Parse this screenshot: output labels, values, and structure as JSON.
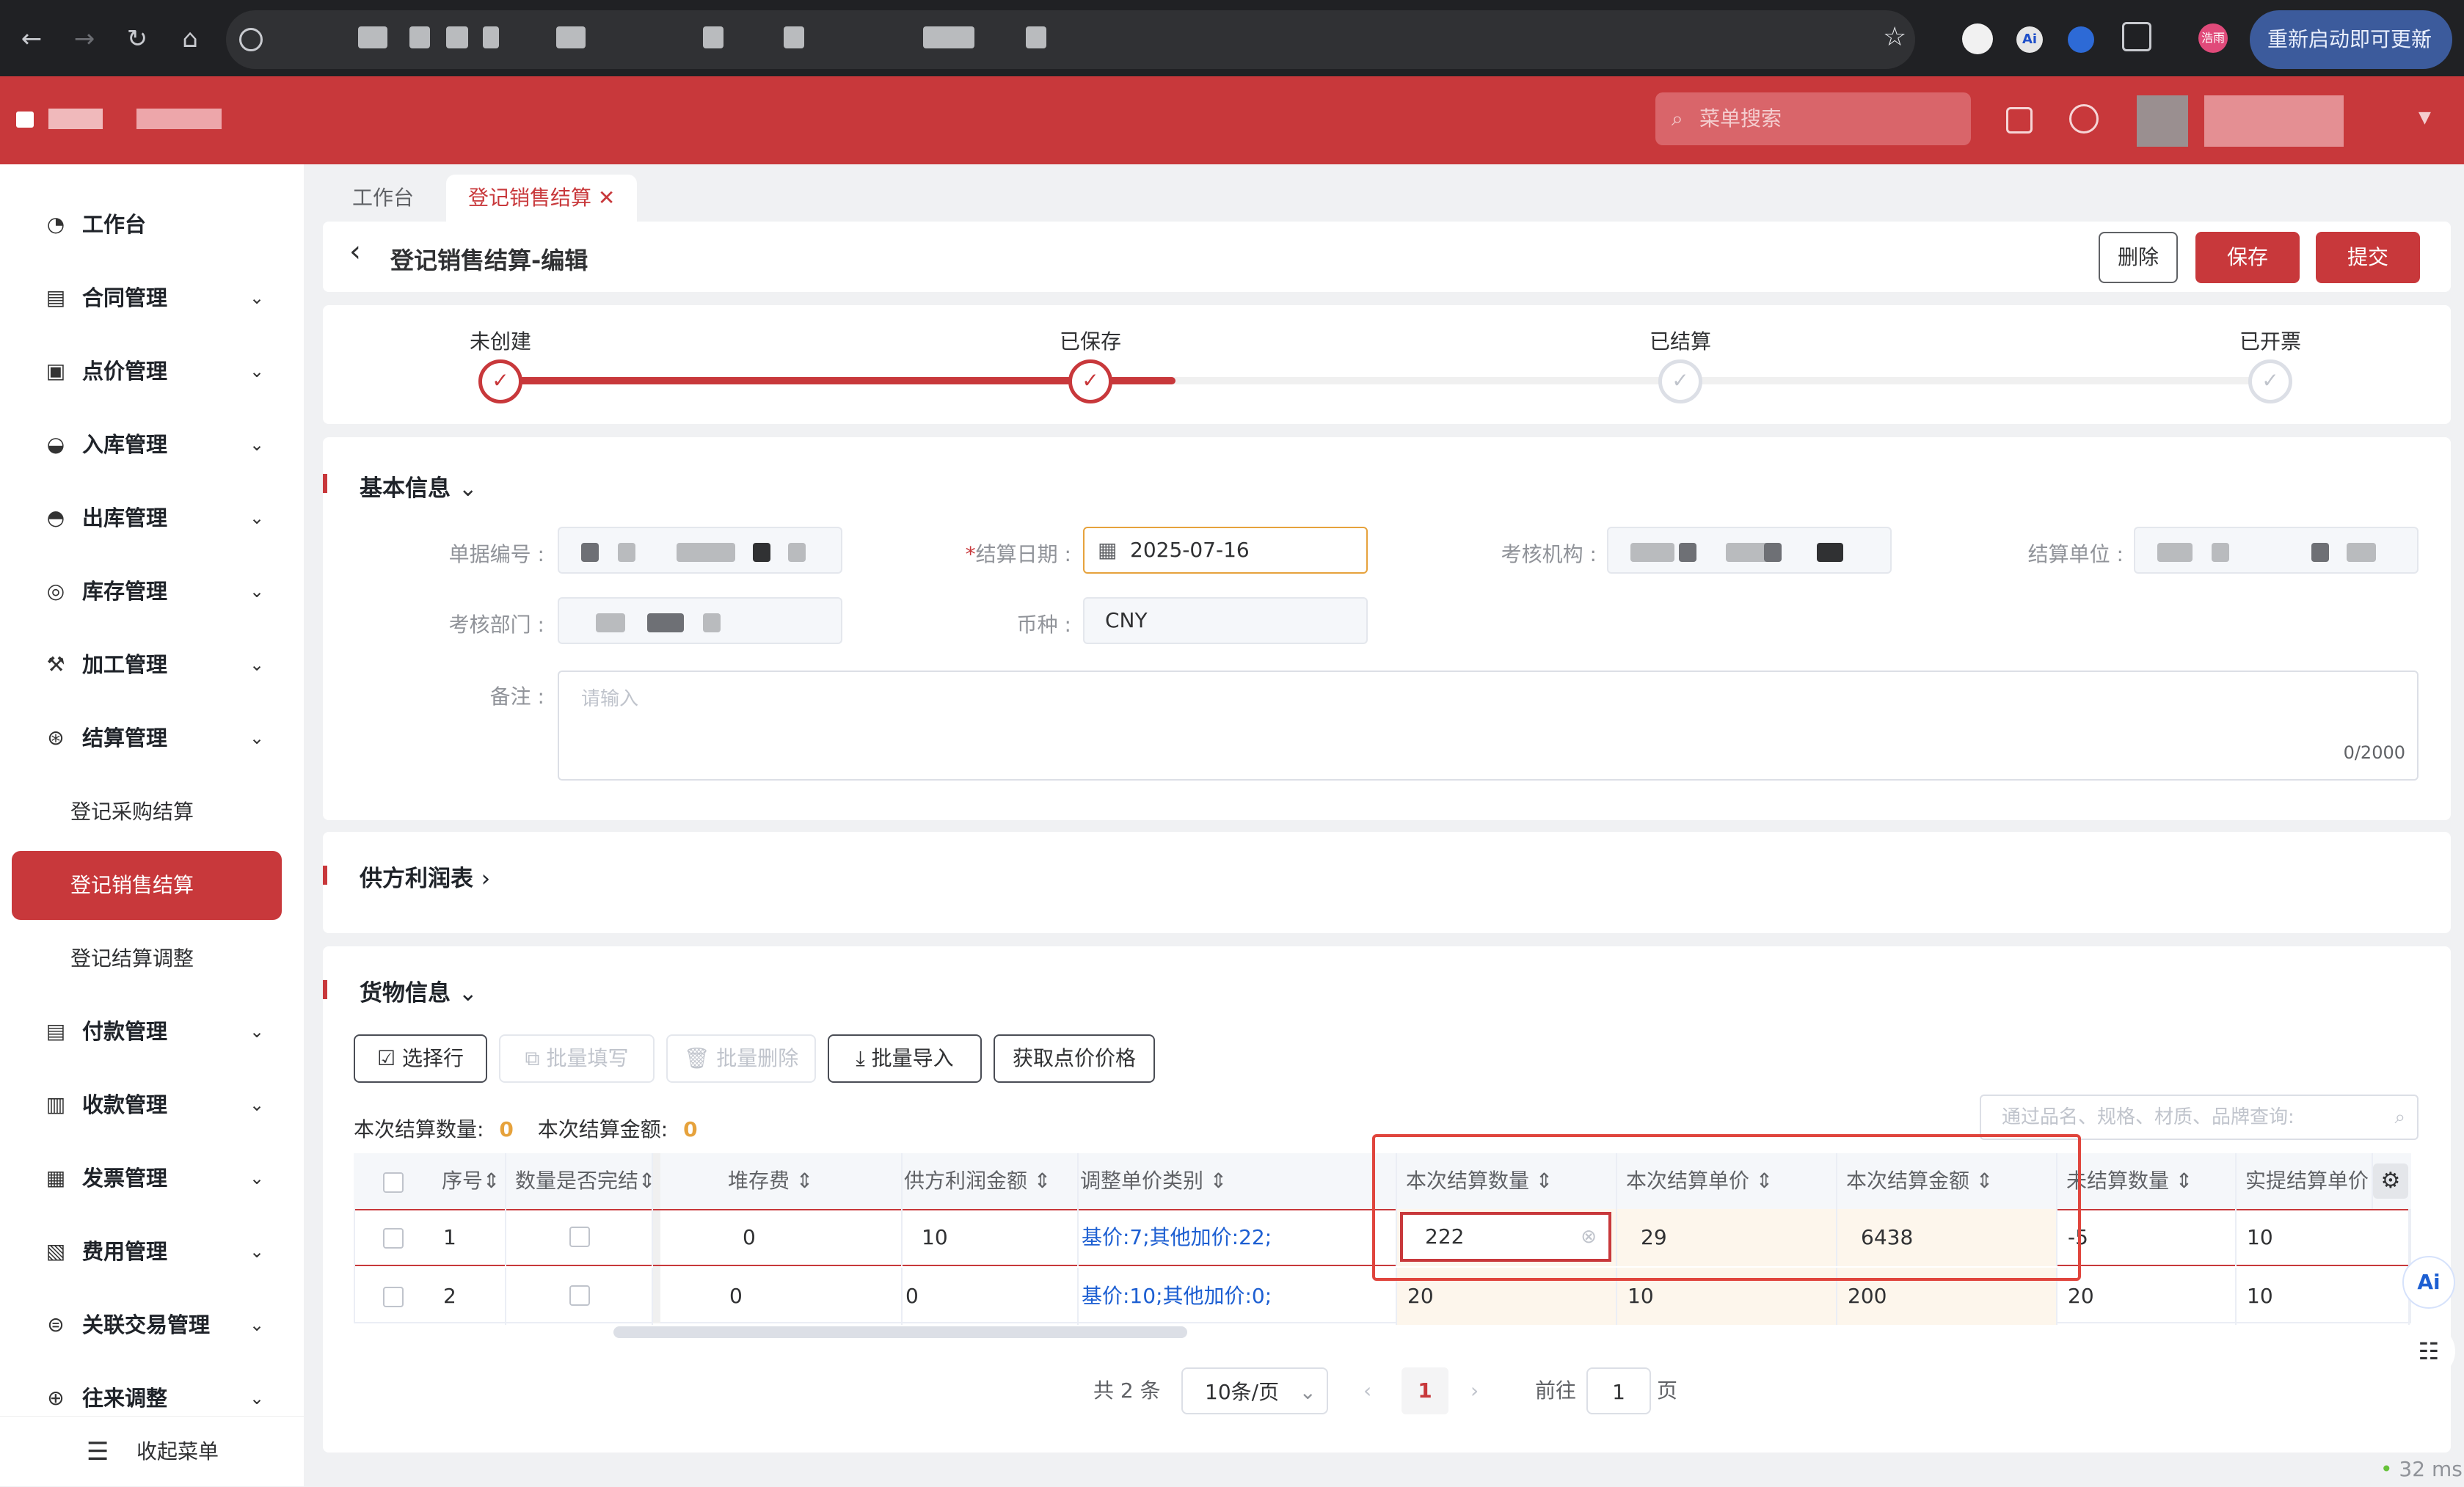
{
  "browser": {
    "update_label": "重新启动即可更新",
    "ext_ai": "Ai",
    "ext_user": "浩雨"
  },
  "header": {
    "search_placeholder": "菜单搜索"
  },
  "sidebar": {
    "items": [
      {
        "label": "工作台"
      },
      {
        "label": "合同管理"
      },
      {
        "label": "点价管理"
      },
      {
        "label": "入库管理"
      },
      {
        "label": "出库管理"
      },
      {
        "label": "库存管理"
      },
      {
        "label": "加工管理"
      },
      {
        "label": "结算管理"
      }
    ],
    "sub_items": [
      {
        "label": "登记采购结算"
      },
      {
        "label": "登记销售结算"
      },
      {
        "label": "登记结算调整"
      }
    ],
    "items2": [
      {
        "label": "付款管理"
      },
      {
        "label": "收款管理"
      },
      {
        "label": "发票管理"
      },
      {
        "label": "费用管理"
      },
      {
        "label": "关联交易管理"
      },
      {
        "label": "往来调整"
      }
    ],
    "collapse_label": "收起菜单"
  },
  "tabs": [
    {
      "label": "工作台"
    },
    {
      "label": "登记销售结算"
    }
  ],
  "tab_close": "✕",
  "page": {
    "back": "‹",
    "title": "登记销售结算-编辑",
    "delete": "删除",
    "save": "保存",
    "submit": "提交"
  },
  "steps": [
    {
      "label": "未创建",
      "done": true
    },
    {
      "label": "已保存",
      "done": true
    },
    {
      "label": "已结算",
      "done": false
    },
    {
      "label": "已开票",
      "done": false
    }
  ],
  "basic": {
    "title": "基本信息",
    "doc_no_label": "单据编号 :",
    "date_label": "结算日期 :",
    "date_required": "*",
    "date_value": "2025-07-16",
    "org_label": "考核机构 :",
    "unit_label": "结算单位 :",
    "dept_label": "考核部门 :",
    "currency_label": "币种 :",
    "currency_value": "CNY",
    "note_label": "备注 :",
    "note_placeholder": "请输入",
    "note_count": "0/2000"
  },
  "profit": {
    "title": "供方利润表"
  },
  "goods": {
    "title": "货物信息",
    "buttons": {
      "select_row": "选择行",
      "batch_fill": "批量填写",
      "batch_delete": "批量删除",
      "batch_import": "批量导入",
      "get_price": "获取点价价格"
    },
    "summary_qty_label": "本次结算数量:",
    "summary_qty": "0",
    "summary_amt_label": "本次结算金额:",
    "summary_amt": "0",
    "search_placeholder": "通过品名、规格、材质、品牌查询:",
    "columns": [
      "序号",
      "数量是否完结",
      "堆存费",
      "供方利润金额",
      "调整单价类别",
      "本次结算数量",
      "本次结算单价",
      "本次结算金额",
      "未结算数量",
      "实提结算单价"
    ],
    "rows": [
      {
        "no": "1",
        "storage": "0",
        "profit": "10",
        "adj_type": "基价:7;其他加价:22;",
        "qty": "222",
        "price": "29",
        "amount": "6438",
        "unsettled": "-5",
        "actual_price": "10"
      },
      {
        "no": "2",
        "storage": "0",
        "profit": "0",
        "adj_type": "基价:10;其他加价:0;",
        "qty": "20",
        "price": "10",
        "amount": "200",
        "unsettled": "20",
        "actual_price": "10"
      }
    ]
  },
  "pagination": {
    "total": "共 2 条",
    "page_size": "10条/页",
    "current": "1",
    "goto_label": "前往",
    "goto_value": "1",
    "page_suffix": "页"
  },
  "latency": "32 ms",
  "colors": {
    "brand": "#c8383b",
    "link": "#1d5fd2",
    "highlight_bg": "#fdf6ec",
    "warn": "#e6a23c"
  }
}
